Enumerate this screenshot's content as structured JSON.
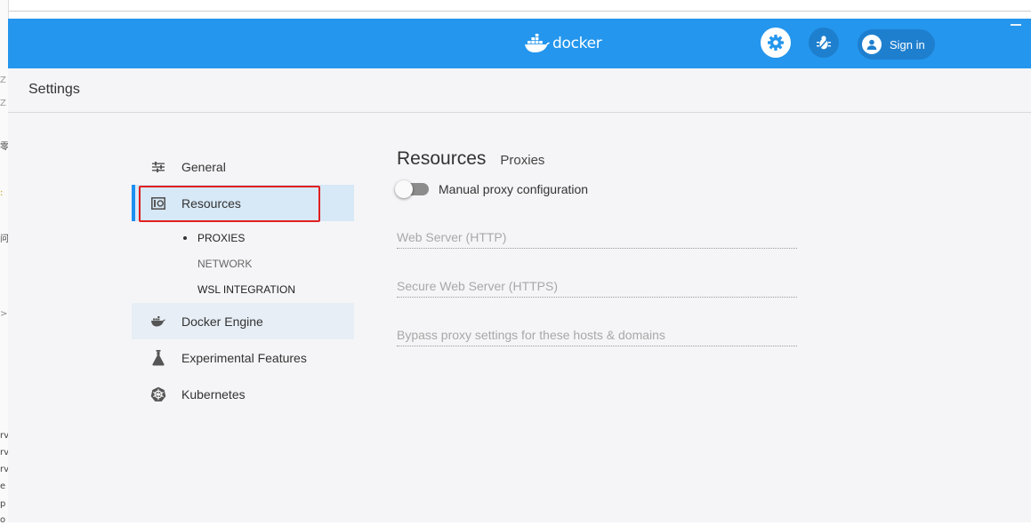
{
  "app": {
    "logo_text": "docker",
    "sign_in_label": "Sign in",
    "settings_title": "Settings",
    "colors": {
      "brand": "#2496ed",
      "active_nav": "#d7e8f6",
      "active_bar": "#1d8ff0",
      "highlight": "#e02020"
    }
  },
  "background_window": {
    "left_strip_chars": [
      "Z",
      "Z",
      "零",
      ":",
      "问",
      ">",
      "rv",
      "rv",
      "rv",
      "e",
      "p",
      "o"
    ]
  },
  "sidebar": {
    "items": [
      {
        "label": "General",
        "icon": "sliders-icon"
      },
      {
        "label": "Resources",
        "icon": "resources-icon",
        "active": true
      },
      {
        "label": "Docker Engine",
        "icon": "whale-icon"
      },
      {
        "label": "Experimental Features",
        "icon": "flask-icon"
      },
      {
        "label": "Kubernetes",
        "icon": "kubernetes-icon"
      }
    ],
    "subitems": [
      {
        "label": "PROXIES",
        "active": true
      },
      {
        "label": "NETWORK"
      },
      {
        "label": "WSL INTEGRATION"
      }
    ]
  },
  "main": {
    "title": "Resources",
    "subtitle": "Proxies",
    "toggle_label": "Manual proxy configuration",
    "toggle_on": false,
    "fields": [
      {
        "placeholder": "Web Server (HTTP)",
        "value": ""
      },
      {
        "placeholder": "Secure Web Server (HTTPS)",
        "value": ""
      },
      {
        "placeholder": "Bypass proxy settings for these hosts & domains",
        "value": ""
      }
    ]
  }
}
